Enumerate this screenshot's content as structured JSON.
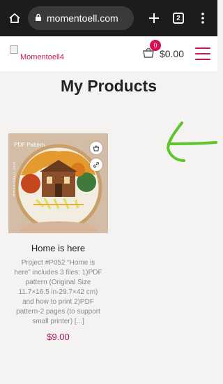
{
  "browser": {
    "url": "momentoell.com",
    "tab_count": "2",
    "icons": [
      "home-icon",
      "lock-icon",
      "plus-icon",
      "tab-switcher-icon",
      "overflow-menu-icon"
    ]
  },
  "header": {
    "logo_alt": "Momentoell4",
    "cart_count": "0",
    "cart_total": "$0.00",
    "brand_color": "#c2185b"
  },
  "page": {
    "title": "My Products"
  },
  "products": [
    {
      "image_badge": "PDF Pattern",
      "image_credit": "momentoell.com",
      "name": "Home is here",
      "description": "Project #P052 “Home is here” includes 3 files: 1)PDF pattern (Original Size 11.7×16.5 in-29.7×42 cm) and how to print 2)PDF pattern-2 pages (to support small printer) [...]",
      "price": "$9.00"
    }
  ]
}
